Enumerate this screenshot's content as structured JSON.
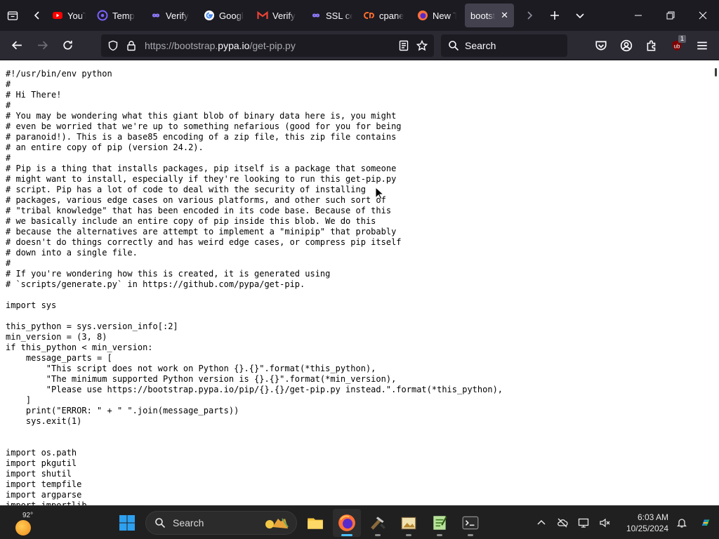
{
  "tabs": [
    {
      "title": "YouTu",
      "icon": "youtube-icon",
      "color": "#ff0000"
    },
    {
      "title": "Temp",
      "icon": "temp-mail-icon",
      "color": "#7b61ff"
    },
    {
      "title": "Verify",
      "icon": "verify-infinity-icon",
      "color": "#8f7bff"
    },
    {
      "title": "Googl",
      "icon": "google-icon",
      "color": "#4285f4"
    },
    {
      "title": "Verify",
      "icon": "gmail-icon",
      "color": "#ea4335"
    },
    {
      "title": "SSL ce",
      "icon": "ssl-infinity-icon",
      "color": "#8f7bff"
    },
    {
      "title": "cpane",
      "icon": "cpanel-icon",
      "color": "#ff6c2c"
    },
    {
      "title": "New T",
      "icon": "firefox-icon",
      "color": "#ff7139"
    },
    {
      "title": "bootstr",
      "icon": "",
      "color": "",
      "active": true
    }
  ],
  "nav": {
    "url_prefix": "https://bootstrap.",
    "url_domain": "pypa.io",
    "url_path": "/get-pip.py",
    "search_placeholder": "Search",
    "extension_badge": "1"
  },
  "code": "#!/usr/bin/env python\n#\n# Hi There!\n#\n# You may be wondering what this giant blob of binary data here is, you might\n# even be worried that we're up to something nefarious (good for you for being\n# paranoid!). This is a base85 encoding of a zip file, this zip file contains\n# an entire copy of pip (version 24.2).\n#\n# Pip is a thing that installs packages, pip itself is a package that someone\n# might want to install, especially if they're looking to run this get-pip.py\n# script. Pip has a lot of code to deal with the security of installing\n# packages, various edge cases on various platforms, and other such sort of\n# \"tribal knowledge\" that has been encoded in its code base. Because of this\n# we basically include an entire copy of pip inside this blob. We do this\n# because the alternatives are attempt to implement a \"minipip\" that probably\n# doesn't do things correctly and has weird edge cases, or compress pip itself\n# down into a single file.\n#\n# If you're wondering how this is created, it is generated using\n# `scripts/generate.py` in https://github.com/pypa/get-pip.\n\nimport sys\n\nthis_python = sys.version_info[:2]\nmin_version = (3, 8)\nif this_python < min_version:\n    message_parts = [\n        \"This script does not work on Python {}.{}\".format(*this_python),\n        \"The minimum supported Python version is {}.{}\".format(*min_version),\n        \"Please use https://bootstrap.pypa.io/pip/{}.{}/get-pip.py instead.\".format(*this_python),\n    ]\n    print(\"ERROR: \" + \" \".join(message_parts))\n    sys.exit(1)\n\n\nimport os.path\nimport pkgutil\nimport shutil\nimport tempfile\nimport argparse\nimport importlib",
  "taskbar": {
    "temperature": "92°",
    "search_placeholder": "Search",
    "time": "6:03 AM",
    "date": "10/25/2024"
  }
}
